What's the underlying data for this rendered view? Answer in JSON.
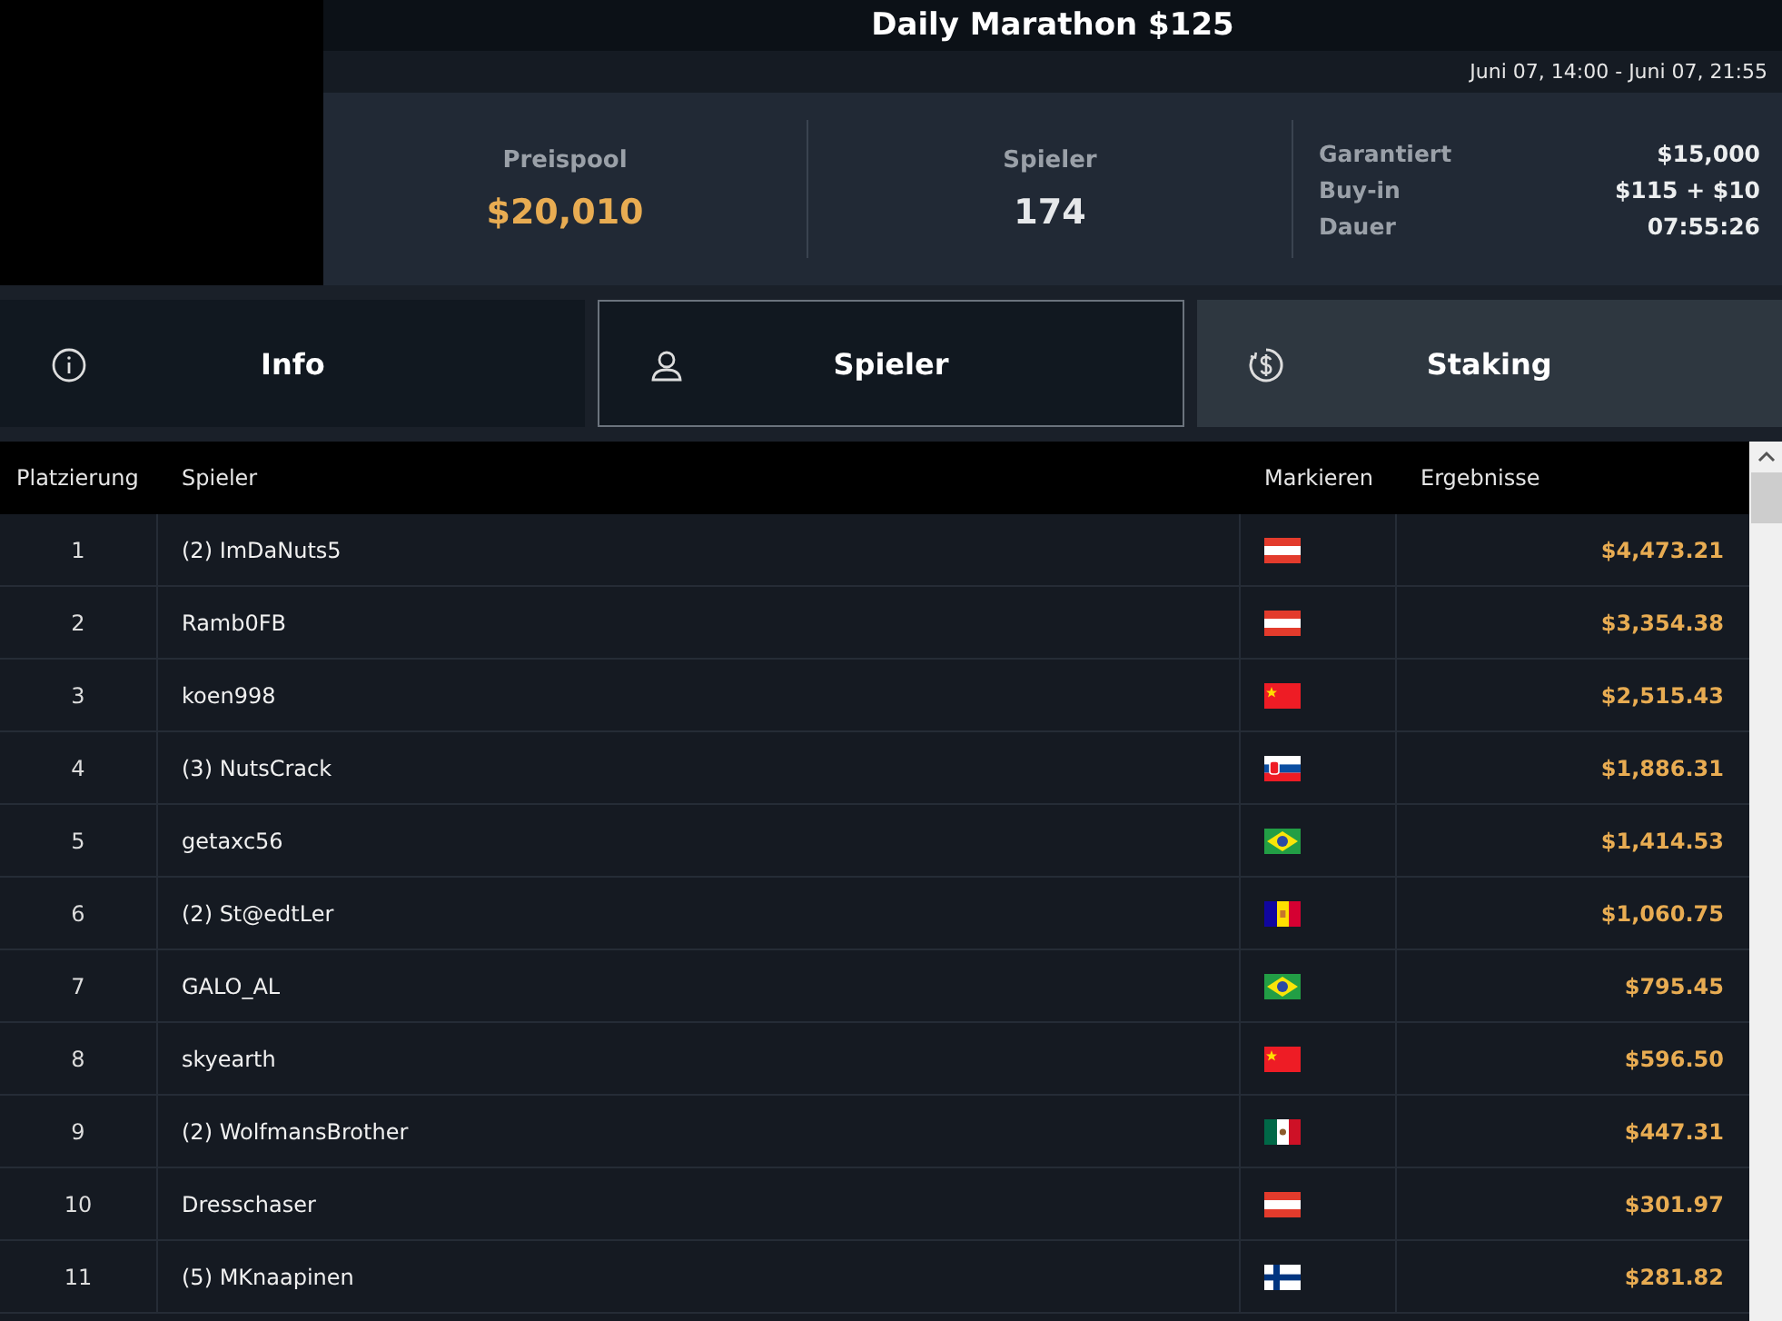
{
  "title": "Daily Marathon $125",
  "schedule": "Juni 07, 14:00 - Juni 07, 21:55",
  "stats": [
    {
      "label": "Preispool",
      "value": "$20,010",
      "kind": "money"
    },
    {
      "label": "Spieler",
      "value": "174",
      "kind": "plain"
    }
  ],
  "details": [
    {
      "label": "Garantiert",
      "value": "$15,000"
    },
    {
      "label": "Buy-in",
      "value": "$115 + $10"
    },
    {
      "label": "Dauer",
      "value": "07:55:26"
    }
  ],
  "tabs": [
    {
      "label": "Info",
      "kind": "info",
      "selected": false,
      "hovered": false
    },
    {
      "label": "Spieler",
      "kind": "person",
      "selected": true,
      "hovered": false
    },
    {
      "label": "Staking",
      "kind": "dollar",
      "selected": false,
      "hovered": true
    }
  ],
  "table": {
    "columns": [
      "Platzierung",
      "Spieler",
      "Markieren",
      "Ergebnisse"
    ],
    "rows": [
      {
        "place": "1",
        "player": "(2) ImDaNuts5",
        "kind": "at",
        "result": "$4,473.21"
      },
      {
        "place": "2",
        "player": "Ramb0FB",
        "kind": "at",
        "result": "$3,354.38"
      },
      {
        "place": "3",
        "player": "koen998",
        "kind": "cn",
        "result": "$2,515.43"
      },
      {
        "place": "4",
        "player": "(3) NutsCrack",
        "kind": "sk",
        "result": "$1,886.31"
      },
      {
        "place": "5",
        "player": "getaxc56",
        "kind": "br",
        "result": "$1,414.53"
      },
      {
        "place": "6",
        "player": "(2) St@edtLer",
        "kind": "ad",
        "result": "$1,060.75"
      },
      {
        "place": "7",
        "player": "GALO_AL",
        "kind": "br",
        "result": "$795.45"
      },
      {
        "place": "8",
        "player": "skyearth",
        "kind": "cn",
        "result": "$596.50"
      },
      {
        "place": "9",
        "player": "(2) WolfmansBrother",
        "kind": "mx",
        "result": "$447.31"
      },
      {
        "place": "10",
        "player": "Dresschaser",
        "kind": "at",
        "result": "$301.97"
      },
      {
        "place": "11",
        "player": "(5) MKnaapinen",
        "kind": "fi",
        "result": "$281.82"
      }
    ]
  }
}
